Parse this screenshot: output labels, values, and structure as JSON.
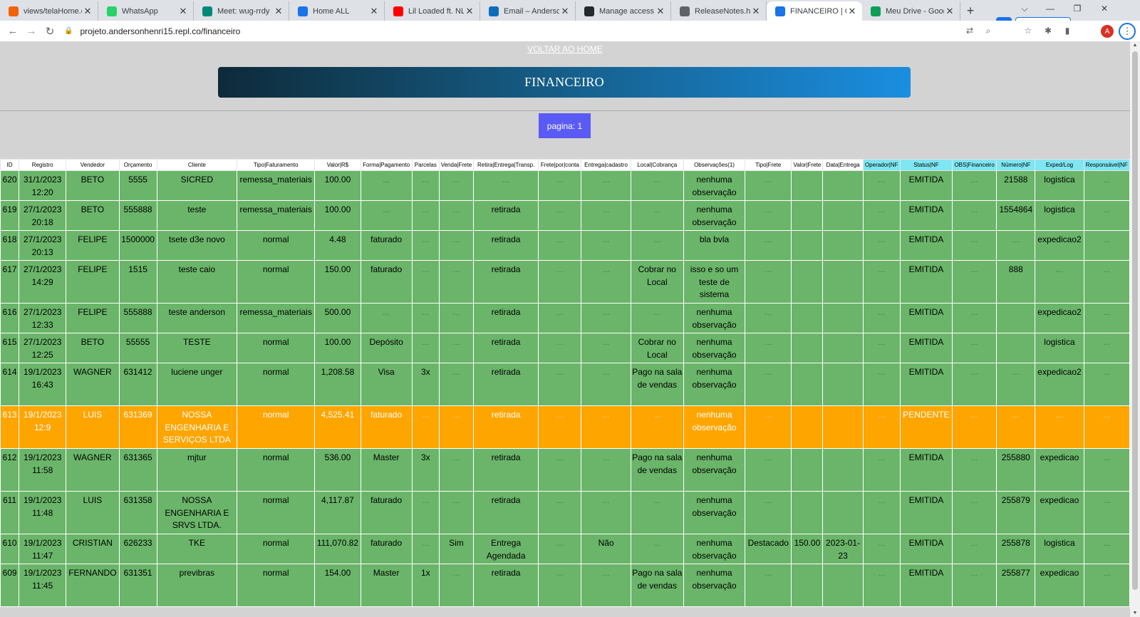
{
  "browser": {
    "tabs": [
      {
        "title": "views/telaHome.ejs",
        "icon": "replit-icon",
        "color": "#f26207"
      },
      {
        "title": "WhatsApp",
        "icon": "whatsapp-icon",
        "color": "#25d366"
      },
      {
        "title": "Meet: wug-rrdy",
        "icon": "meet-icon",
        "color": "#00897b"
      },
      {
        "title": "Home ALL",
        "icon": "replit-icon",
        "color": "#1a73e8"
      },
      {
        "title": "Lil Loaded ft. NLE Ch",
        "icon": "youtube-icon",
        "color": "#ff0000"
      },
      {
        "title": "Email – Anderson H",
        "icon": "outlook-icon",
        "color": "#0f6cbd"
      },
      {
        "title": "Manage access",
        "icon": "github-icon",
        "color": "#24292f"
      },
      {
        "title": "ReleaseNotes.html",
        "icon": "globe-icon",
        "color": "#5f6368"
      },
      {
        "title": "FINANCEIRO | CEM",
        "icon": "replit-icon",
        "color": "#1a73e8"
      },
      {
        "title": "Meu Drive - Google",
        "icon": "drive-icon",
        "color": "#0f9d58"
      }
    ],
    "active_tab": 8,
    "url": "projeto.andersonhenri15.repl.co/financeiro",
    "terabox_label": "TeraBox",
    "profile_initial": "A"
  },
  "page": {
    "home_link": "VOLTAR AO HOME",
    "title": "FINANCEIRO",
    "pager": "pagina: 1"
  },
  "table": {
    "columns": [
      {
        "label": "ID",
        "cyan": false
      },
      {
        "label": "Registro",
        "cyan": false
      },
      {
        "label": "Vendedor",
        "cyan": false
      },
      {
        "label": "Orçamento",
        "cyan": false
      },
      {
        "label": "Cliente",
        "cyan": false
      },
      {
        "label": "Tipo|Faturamento",
        "cyan": false
      },
      {
        "label": "Valor|R$",
        "cyan": false
      },
      {
        "label": "Forma|Pagamento",
        "cyan": false
      },
      {
        "label": "Parcelas",
        "cyan": false
      },
      {
        "label": "Venda|Frete",
        "cyan": false
      },
      {
        "label": "Retira|Entrega|Transp.",
        "cyan": false
      },
      {
        "label": "Frete|por|conta",
        "cyan": false
      },
      {
        "label": "Entrega|cadastro",
        "cyan": false
      },
      {
        "label": "Local|Cobrança",
        "cyan": false
      },
      {
        "label": "Observações(1)",
        "cyan": false
      },
      {
        "label": "Tipo|Frete",
        "cyan": false
      },
      {
        "label": "Valor|Frete",
        "cyan": false
      },
      {
        "label": "Data|Entrega",
        "cyan": false
      },
      {
        "label": "Operador|NF",
        "cyan": true
      },
      {
        "label": "Status|NF",
        "cyan": true
      },
      {
        "label": "OBS|Financeiro",
        "cyan": true
      },
      {
        "label": "Número|NF",
        "cyan": true
      },
      {
        "label": "Exped/Log",
        "cyan": true
      },
      {
        "label": "Responsável|NF",
        "cyan": true
      }
    ],
    "rows": [
      {
        "status": "ok",
        "cells": [
          "620",
          "31/1/2023 12:20",
          "BETO",
          "5555",
          "SICRED",
          "remessa_materiais",
          "100.00",
          "...",
          "...",
          "...",
          "...",
          "...",
          "...",
          "...",
          "nenhuma observação",
          "...",
          "",
          "",
          "...",
          "EMITIDA",
          "...",
          "21588",
          "logistica",
          "..."
        ]
      },
      {
        "status": "ok",
        "cells": [
          "619",
          "27/1/2023 20:18",
          "BETO",
          "555888",
          "teste",
          "remessa_materiais",
          "100.00",
          "...",
          "...",
          "...",
          "retirada",
          "...",
          "...",
          "...",
          "nenhuma observação",
          "...",
          "",
          "",
          "...",
          "EMITIDA",
          "...",
          "1554864",
          "logistica",
          "..."
        ]
      },
      {
        "status": "ok",
        "cells": [
          "618",
          "27/1/2023 20:13",
          "FELIPE",
          "1500000",
          "tsete d3e novo",
          "normal",
          "4.48",
          "faturado",
          "...",
          "...",
          "retirada",
          "...",
          "...",
          "...",
          "bla bvla",
          "...",
          "",
          "",
          "...",
          "EMITIDA",
          "...",
          "...",
          "expedicao2",
          "..."
        ]
      },
      {
        "status": "ok",
        "cells": [
          "617",
          "27/1/2023 14:29",
          "FELIPE",
          "1515",
          "teste caio",
          "normal",
          "150.00",
          "faturado",
          "...",
          "...",
          "retirada",
          "...",
          "...",
          "Cobrar no Local",
          "isso e so um teste de sistema",
          "...",
          "",
          "",
          "...",
          "EMITIDA",
          "...",
          "888",
          "...",
          "..."
        ]
      },
      {
        "status": "ok",
        "cells": [
          "616",
          "27/1/2023 12:33",
          "FELIPE",
          "555888",
          "teste anderson",
          "remessa_materiais",
          "500.00",
          "...",
          "...",
          "...",
          "retirada",
          "...",
          "...",
          "...",
          "nenhuma observação",
          "...",
          "",
          "",
          "...",
          "EMITIDA",
          "...",
          "",
          "expedicao2",
          "..."
        ]
      },
      {
        "status": "ok",
        "cells": [
          "615",
          "27/1/2023 12:25",
          "BETO",
          "55555",
          "TESTE",
          "normal",
          "100.00",
          "Depósito",
          "...",
          "...",
          "retirada",
          "...",
          "...",
          "Cobrar no Local",
          "nenhuma observação",
          "...",
          "",
          "",
          "...",
          "EMITIDA",
          "...",
          "",
          "logistica",
          "..."
        ]
      },
      {
        "status": "ok",
        "cells": [
          "614",
          "19/1/2023 16:43",
          "WAGNER",
          "631412",
          "luciene unger",
          "normal",
          "1,208.58",
          "Visa",
          "3x",
          "...",
          "retirada",
          "...",
          "...",
          "Pago na sala de vendas",
          "nenhuma observação",
          "...",
          "",
          "",
          "...",
          "EMITIDA",
          "...",
          "...",
          "expedicao2",
          "..."
        ]
      },
      {
        "status": "pend",
        "cells": [
          "613",
          "19/1/2023 12:9",
          "LUIS",
          "631369",
          "NOSSA ENGENHARIA E SERVIÇOS LTDA",
          "normal",
          "4,525.41",
          "faturado",
          "...",
          "...",
          "retirada",
          "...",
          "...",
          "...",
          "nenhuma observação",
          "...",
          "",
          "",
          "...",
          "PENDENTE",
          "...",
          "...",
          "...",
          "..."
        ]
      },
      {
        "status": "ok",
        "cells": [
          "612",
          "19/1/2023 11:58",
          "WAGNER",
          "631365",
          "mjtur",
          "normal",
          "536.00",
          "Master",
          "3x",
          "...",
          "retirada",
          "...",
          "...",
          "Pago na sala de vendas",
          "nenhuma observação",
          "...",
          "",
          "",
          "...",
          "EMITIDA",
          "...",
          "255880",
          "expedicao",
          "..."
        ]
      },
      {
        "status": "ok",
        "cells": [
          "611",
          "19/1/2023 11:48",
          "LUIS",
          "631358",
          "NOSSA ENGENHARIA E SRVS LTDA.",
          "normal",
          "4,117.87",
          "faturado",
          "...",
          "...",
          "retirada",
          "...",
          "...",
          "...",
          "nenhuma observação",
          "...",
          "",
          "",
          "...",
          "EMITIDA",
          "...",
          "255879",
          "expedicao",
          "..."
        ]
      },
      {
        "status": "ok",
        "cells": [
          "610",
          "19/1/2023 11:47",
          "CRISTIAN",
          "626233",
          "TKE",
          "normal",
          "111,070.82",
          "faturado",
          "...",
          "Sim",
          "Entrega Agendada",
          "...",
          "Não",
          "...",
          "nenhuma observação",
          "Destacado",
          "150.00",
          "2023-01-23",
          "...",
          "EMITIDA",
          "...",
          "255878",
          "logistica",
          "..."
        ]
      },
      {
        "status": "ok",
        "cells": [
          "609",
          "19/1/2023 11:45",
          "FERNANDO",
          "631351",
          "previbras",
          "normal",
          "154.00",
          "Master",
          "1x",
          "...",
          "retirada",
          "...",
          "...",
          "Pago na sala de vendas",
          "nenhuma observação",
          "...",
          "",
          "",
          "...",
          "EMITIDA",
          "...",
          "255877",
          "expedicao",
          "..."
        ]
      }
    ]
  }
}
